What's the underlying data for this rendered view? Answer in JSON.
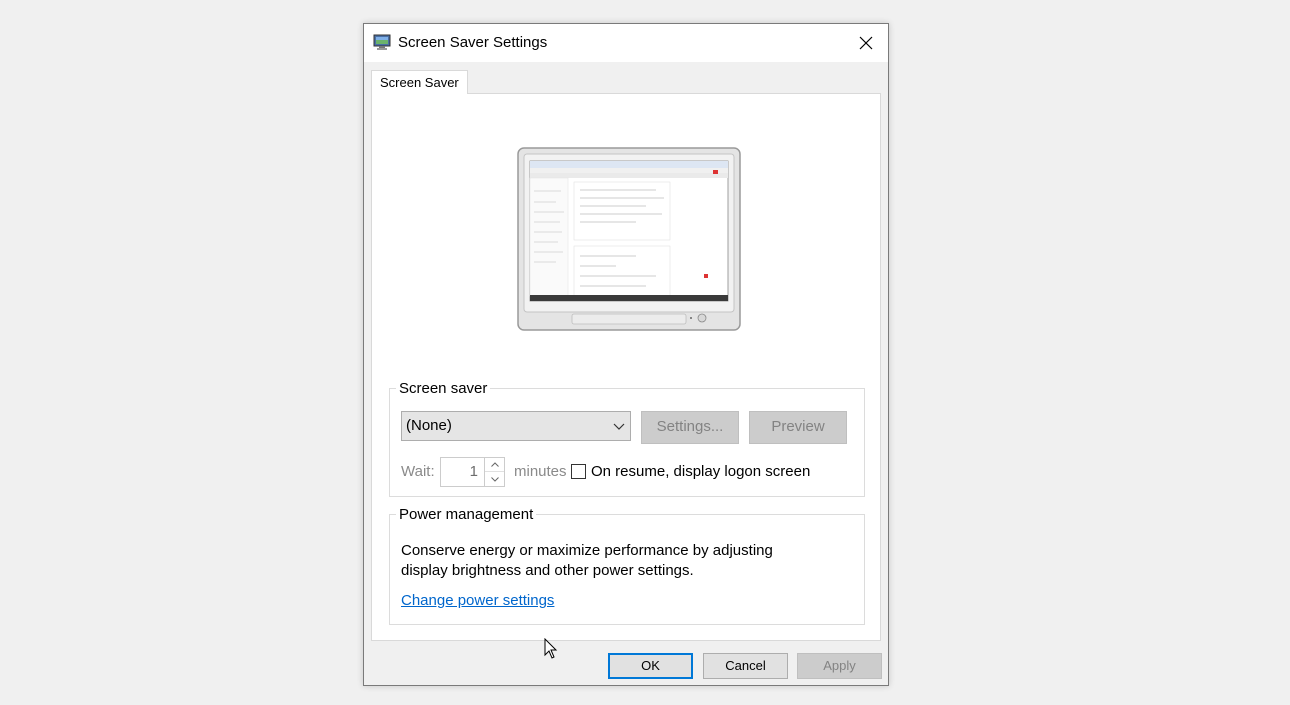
{
  "window": {
    "title": "Screen Saver Settings",
    "icon": "screen-saver-monitor-icon",
    "close_icon": "close-icon"
  },
  "tabs": [
    {
      "label": "Screen Saver",
      "active": true
    }
  ],
  "preview": {
    "icon": "monitor-preview-image"
  },
  "screen_saver_group": {
    "legend": "Screen saver",
    "selected": "(None)",
    "settings_label": "Settings...",
    "preview_label": "Preview",
    "wait_label": "Wait:",
    "wait_value": "1",
    "minutes_label": "minutes",
    "logon_checkbox_label": "On resume, display logon screen",
    "logon_checked": false
  },
  "power_group": {
    "legend": "Power management",
    "description": "Conserve energy or maximize performance by adjusting display brightness and other power settings.",
    "link": "Change power settings"
  },
  "buttons": {
    "ok": "OK",
    "cancel": "Cancel",
    "apply": "Apply"
  },
  "colors": {
    "accent": "#0078d7",
    "link": "#0066cc",
    "disabled_text": "#838383",
    "disabled_bg": "#cccccc"
  }
}
